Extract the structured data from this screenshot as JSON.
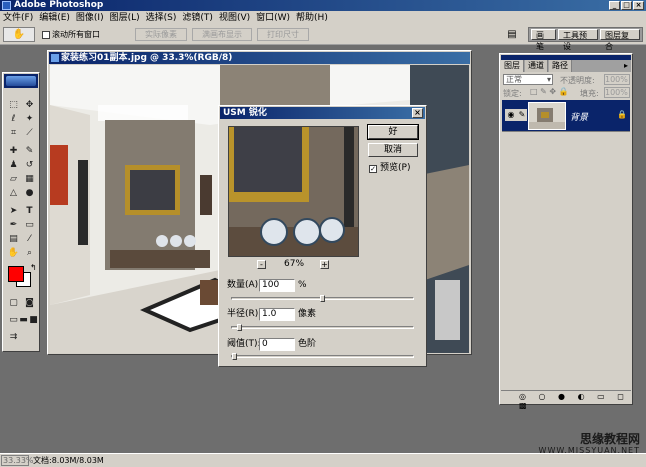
{
  "window": {
    "title": "Adobe Photoshop",
    "controls": [
      "_",
      "□",
      "×"
    ]
  },
  "menu": [
    "文件(F)",
    "编辑(E)",
    "图像(I)",
    "图层(L)",
    "选择(S)",
    "滤镜(T)",
    "视图(V)",
    "窗口(W)",
    "帮助(H)"
  ],
  "options": {
    "preset_glyph": "✋",
    "scroll_all_label": "滚动所有窗口",
    "buttons": [
      "实际像素",
      "满画布显示",
      "打印尺寸"
    ],
    "well_tabs": [
      "画笔",
      "工具预设",
      "图层复合"
    ]
  },
  "document": {
    "title": "家装练习01副本.jpg @ 33.3%(RGB/8)"
  },
  "dialog": {
    "title": "USM 锐化",
    "ok": "好",
    "cancel": "取消",
    "preview_label": "预览(P)",
    "preview_zoom": "67%",
    "zoom_out": "-",
    "zoom_in": "+",
    "amount_label": "数量(A):",
    "amount_value": "100",
    "amount_unit": "%",
    "amount_fraction": 0.5,
    "radius_label": "半径(R):",
    "radius_value": "1.0",
    "radius_unit": "像素",
    "radius_fraction": 0.03,
    "threshold_label": "阈值(T):",
    "threshold_value": "0",
    "threshold_unit": "色阶",
    "threshold_fraction": 0.0
  },
  "layers": {
    "tabs": [
      "图层",
      "通道",
      "路径"
    ],
    "blend_mode": "正常",
    "opacity_label": "不透明度:",
    "opacity_value": "100%",
    "lock_label": "锁定:",
    "fill_label": "填充:",
    "fill_value": "100%",
    "layer_name": "背景"
  },
  "status": {
    "zoom": "33.33%",
    "doc": "文档:8.03M/8.03M"
  },
  "watermark": {
    "text": "思缘教程网",
    "url": "WWW.MISSYUAN.NET"
  },
  "colors": {
    "titlebar": "#0a246a",
    "foreground": "#ff0000",
    "background": "#ffffff"
  }
}
